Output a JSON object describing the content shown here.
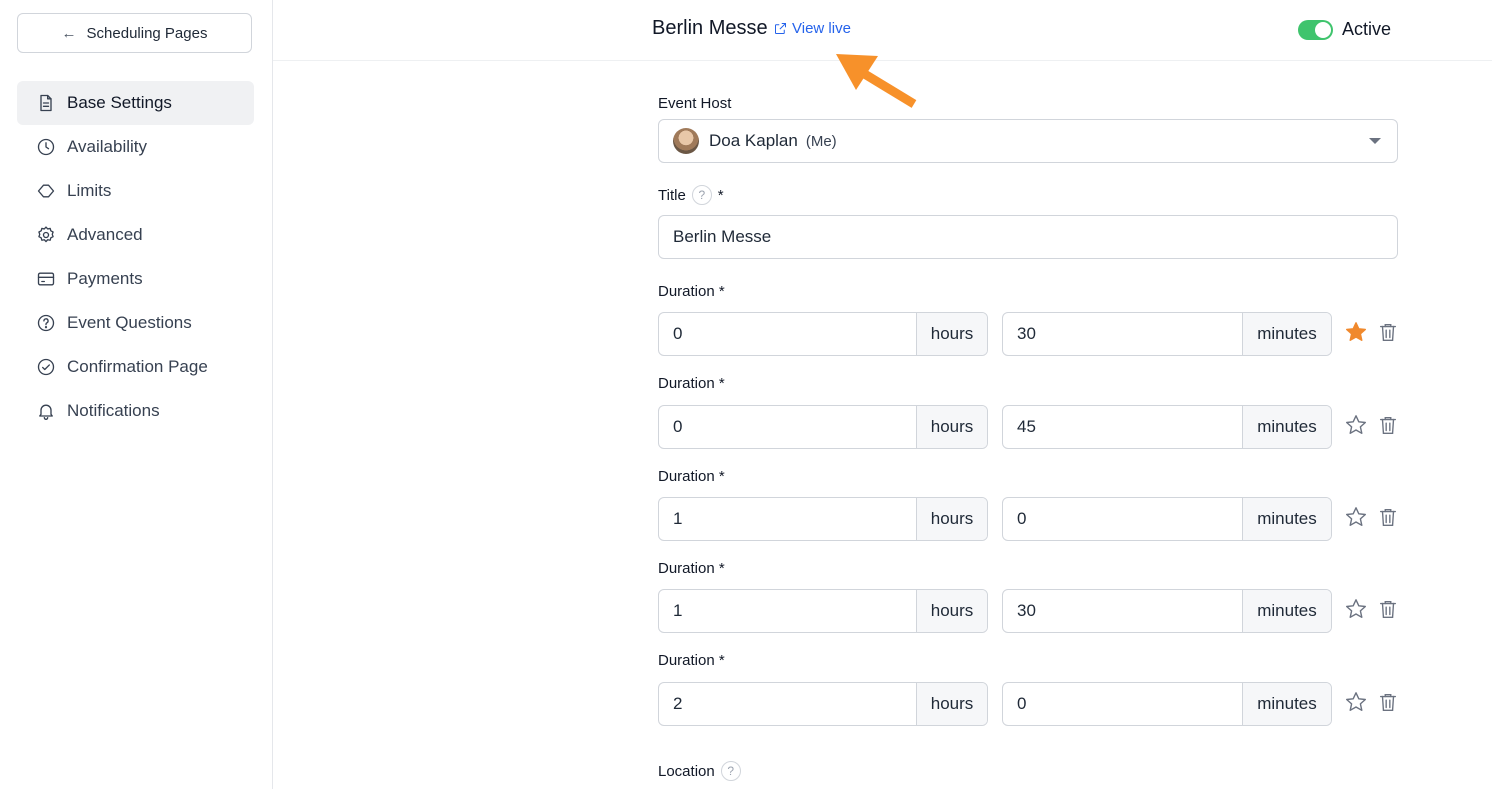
{
  "sidebar": {
    "back_label": "Scheduling Pages",
    "items": [
      {
        "label": "Base Settings",
        "icon": "document-icon",
        "active": true
      },
      {
        "label": "Availability",
        "icon": "clock-icon"
      },
      {
        "label": "Limits",
        "icon": "limits-icon"
      },
      {
        "label": "Advanced",
        "icon": "gear-icon"
      },
      {
        "label": "Payments",
        "icon": "card-icon"
      },
      {
        "label": "Event Questions",
        "icon": "question-icon"
      },
      {
        "label": "Confirmation Page",
        "icon": "check-circle-icon"
      },
      {
        "label": "Notifications",
        "icon": "bell-icon"
      }
    ]
  },
  "header": {
    "title": "Berlin Messe",
    "view_live": "View live",
    "status_label": "Active",
    "status_on": true
  },
  "form": {
    "host_label": "Event Host",
    "host_name": "Doa Kaplan",
    "host_me": "(Me)",
    "title_label": "Title",
    "title_required": "*",
    "title_value": "Berlin Messe",
    "duration_label": "Duration *",
    "hours_unit": "hours",
    "minutes_unit": "minutes",
    "durations": [
      {
        "hours": "0",
        "minutes": "30",
        "starred": true
      },
      {
        "hours": "0",
        "minutes": "45",
        "starred": false
      },
      {
        "hours": "1",
        "minutes": "0",
        "starred": false
      },
      {
        "hours": "1",
        "minutes": "30",
        "starred": false
      },
      {
        "hours": "2",
        "minutes": "0",
        "starred": false
      }
    ],
    "location_label": "Location"
  },
  "colors": {
    "accent_blue": "#2563eb",
    "toggle_green": "#3fc46d",
    "star_orange": "#f0892d",
    "annotation_arrow": "#f7912a"
  }
}
